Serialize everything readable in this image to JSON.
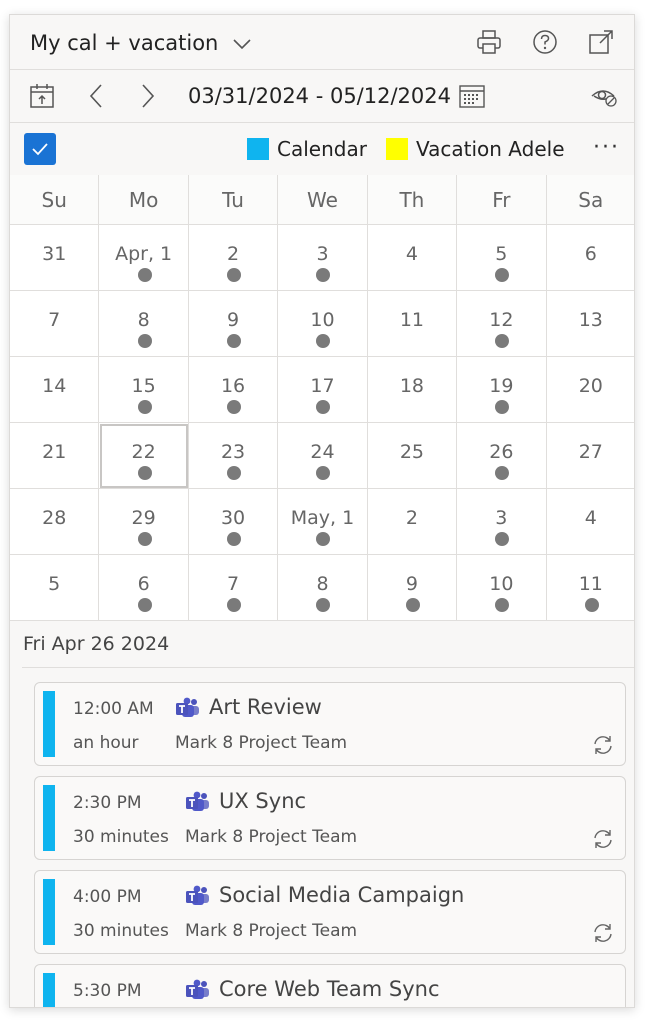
{
  "header": {
    "title": "My cal + vacation"
  },
  "toolbar": {
    "date_range": "03/31/2024 - 05/12/2024"
  },
  "legend": [
    {
      "label": "Calendar",
      "color": "#0fb4ef"
    },
    {
      "label": "Vacation Adele",
      "color": "#ffff00"
    }
  ],
  "more_label": "···",
  "weekdays": [
    "Su",
    "Mo",
    "Tu",
    "We",
    "Th",
    "Fr",
    "Sa"
  ],
  "calendar_days": [
    {
      "label": "31",
      "dot": false
    },
    {
      "label": "Apr, 1",
      "dot": true
    },
    {
      "label": "2",
      "dot": true
    },
    {
      "label": "3",
      "dot": true
    },
    {
      "label": "4",
      "dot": false
    },
    {
      "label": "5",
      "dot": true
    },
    {
      "label": "6",
      "dot": false
    },
    {
      "label": "7",
      "dot": false
    },
    {
      "label": "8",
      "dot": true
    },
    {
      "label": "9",
      "dot": true
    },
    {
      "label": "10",
      "dot": true
    },
    {
      "label": "11",
      "dot": false
    },
    {
      "label": "12",
      "dot": true
    },
    {
      "label": "13",
      "dot": false
    },
    {
      "label": "14",
      "dot": false
    },
    {
      "label": "15",
      "dot": true
    },
    {
      "label": "16",
      "dot": true
    },
    {
      "label": "17",
      "dot": true
    },
    {
      "label": "18",
      "dot": false
    },
    {
      "label": "19",
      "dot": true
    },
    {
      "label": "20",
      "dot": false
    },
    {
      "label": "21",
      "dot": false
    },
    {
      "label": "22",
      "dot": true,
      "selected": true
    },
    {
      "label": "23",
      "dot": true
    },
    {
      "label": "24",
      "dot": true
    },
    {
      "label": "25",
      "dot": false
    },
    {
      "label": "26",
      "dot": true
    },
    {
      "label": "27",
      "dot": false
    },
    {
      "label": "28",
      "dot": false
    },
    {
      "label": "29",
      "dot": true
    },
    {
      "label": "30",
      "dot": true
    },
    {
      "label": "May, 1",
      "dot": true
    },
    {
      "label": "2",
      "dot": false
    },
    {
      "label": "3",
      "dot": true
    },
    {
      "label": "4",
      "dot": false
    },
    {
      "label": "5",
      "dot": false
    },
    {
      "label": "6",
      "dot": true
    },
    {
      "label": "7",
      "dot": true
    },
    {
      "label": "8",
      "dot": true
    },
    {
      "label": "9",
      "dot": true
    },
    {
      "label": "10",
      "dot": true
    },
    {
      "label": "11",
      "dot": true
    }
  ],
  "selected_date_label": "Fri Apr 26 2024",
  "events": [
    {
      "time": "12:00 AM",
      "duration": "an hour",
      "title": "Art Review",
      "organizer": "Mark 8 Project Team"
    },
    {
      "time": "2:30 PM",
      "duration": "30 minutes",
      "title": "UX Sync",
      "organizer": "Mark 8 Project Team"
    },
    {
      "time": "4:00 PM",
      "duration": "30 minutes",
      "title": "Social Media Campaign",
      "organizer": "Mark 8 Project Team"
    },
    {
      "time": "5:30 PM",
      "duration": "",
      "title": "Core Web Team Sync",
      "organizer": ""
    }
  ]
}
